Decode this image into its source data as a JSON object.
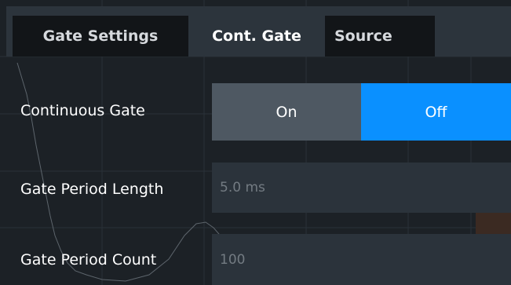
{
  "tabs": [
    {
      "label": "Gate Settings",
      "active": false
    },
    {
      "label": "Cont. Gate",
      "active": true
    },
    {
      "label": "Source",
      "active": false
    }
  ],
  "continuous_gate": {
    "label": "Continuous Gate",
    "options": [
      "On",
      "Off"
    ],
    "selected": "Off"
  },
  "gate_period_length": {
    "label": "Gate Period Length",
    "value": "5.0 ms"
  },
  "gate_period_count": {
    "label": "Gate Period Count",
    "value": "100"
  },
  "colors": {
    "accent": "#0a90ff",
    "background": "#1c2126",
    "panel": "#2c343c",
    "toggle_bg": "#4e5862",
    "field_text": "#737b82"
  }
}
